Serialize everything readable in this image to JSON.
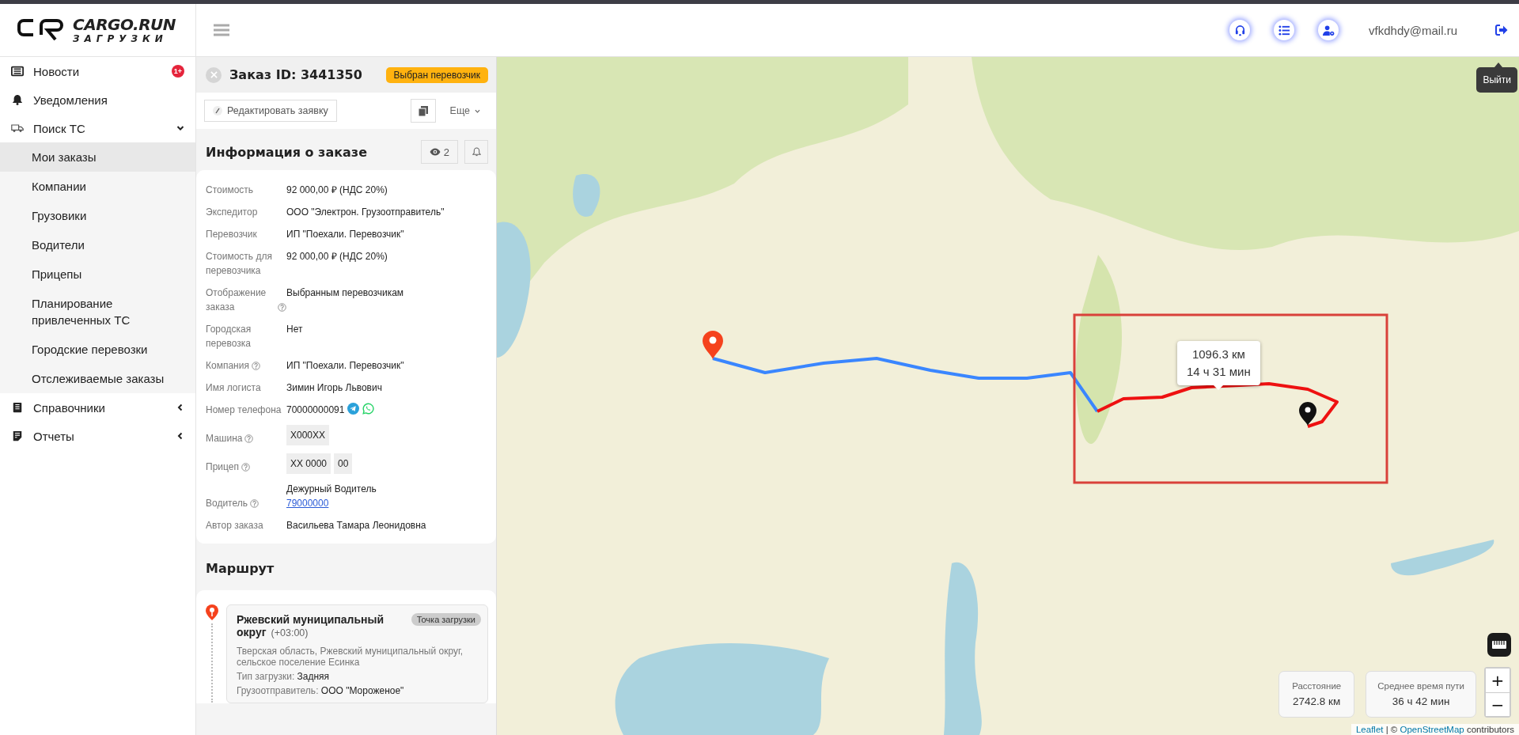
{
  "header": {
    "logo": {
      "title": "CARGO.RUN",
      "subtitle": "ЗАГРУЗКИ"
    },
    "user_email": "vfkdhdy@mail.ru",
    "logout_tooltip": "Выйти"
  },
  "sidebar": {
    "items": [
      {
        "label": "Новости",
        "kind": "news",
        "badge": "1+"
      },
      {
        "label": "Уведомления",
        "kind": "bell"
      },
      {
        "label": "Поиск ТС",
        "kind": "truck",
        "expanded": true,
        "children": [
          {
            "label": "Мои заказы",
            "selected": true
          },
          {
            "label": "Компании",
            "selected": false
          },
          {
            "label": "Грузовики",
            "selected": false
          },
          {
            "label": "Водители",
            "selected": false
          },
          {
            "label": "Прицепы",
            "selected": false
          },
          {
            "label": "Планирование привлеченных ТС",
            "selected": false
          },
          {
            "label": "Городские перевозки",
            "selected": false
          },
          {
            "label": "Отслеживаемые заказы",
            "selected": false
          }
        ]
      },
      {
        "label": "Справочники",
        "kind": "book",
        "expanded": false
      },
      {
        "label": "Отчеты",
        "kind": "report",
        "expanded": false
      }
    ]
  },
  "order": {
    "title": "Заказ ID: 3441350",
    "status": "Выбран перевозчик",
    "edit_button": "Редактировать заявку",
    "more_button": "Еще",
    "info": {
      "title": "Информация о заказе",
      "views": "2",
      "fields": [
        {
          "label": "Стоимость",
          "help": false,
          "kind": "text",
          "value": "92 000,00 ₽ (НДС 20%)"
        },
        {
          "label": "Экспедитор",
          "help": false,
          "kind": "text",
          "value": "ООО \"Электрон. Грузоотправитель\""
        },
        {
          "label": "Перевозчик",
          "help": false,
          "kind": "text",
          "value": "ИП \"Поехали. Перевозчик\""
        },
        {
          "label": "Стоимость для перевозчика",
          "help": false,
          "kind": "text",
          "value": "92 000,00 ₽ (НДС 20%)"
        },
        {
          "label": "Отображение заказа",
          "help": true,
          "kind": "text",
          "value": "Выбранным перевозчикам"
        },
        {
          "label": "Городская перевозка",
          "help": false,
          "kind": "text",
          "value": "Нет"
        },
        {
          "label": "Компания",
          "help": true,
          "kind": "text",
          "value": "ИП \"Поехали. Перевозчик\""
        },
        {
          "label": "Имя логиста",
          "help": false,
          "kind": "text",
          "value": "Зимин Игорь Львович"
        },
        {
          "label": "Номер телефона",
          "help": false,
          "kind": "phone",
          "value": "70000000091"
        },
        {
          "label": "Машина",
          "help": true,
          "kind": "plate",
          "parts": [
            "X000XX"
          ]
        },
        {
          "label": "Прицеп",
          "help": true,
          "kind": "plate",
          "parts": [
            "XX 0000",
            "00"
          ]
        },
        {
          "label": "Водитель",
          "help": true,
          "kind": "person",
          "value": "Дежурный Водитель",
          "link": "79000000"
        },
        {
          "label": "Автор заказа",
          "help": false,
          "kind": "text",
          "value": "Васильева Тамара Леонидовна"
        }
      ]
    },
    "route": {
      "title": "Маршрут",
      "points": [
        {
          "name": "Ржевский муниципальный округ",
          "timezone": "(+03:00)",
          "tag": "Точка загрузки",
          "address": "Тверская область, Ржевский муниципальный округ, сельское поселение Есинка",
          "details": [
            {
              "label": "Тип загрузки:",
              "value": "Задняя"
            },
            {
              "label": "Грузоотправитель:",
              "value": "ООО \"Мороженое\""
            }
          ]
        }
      ]
    }
  },
  "map": {
    "tooltip": {
      "distance": "1096.3 км",
      "time": "14 ч 31 мин"
    },
    "stats": [
      {
        "label": "Расстояние",
        "value": "2742.8 км"
      },
      {
        "label": "Среднее время пути",
        "value": "36 ч 42 мин"
      }
    ],
    "zoom_in": "+",
    "zoom_out": "−",
    "attribution": {
      "leaflet": "Leaflet",
      "separator": " | © ",
      "osm": "OpenStreetMap",
      "suffix": " contributors"
    }
  }
}
